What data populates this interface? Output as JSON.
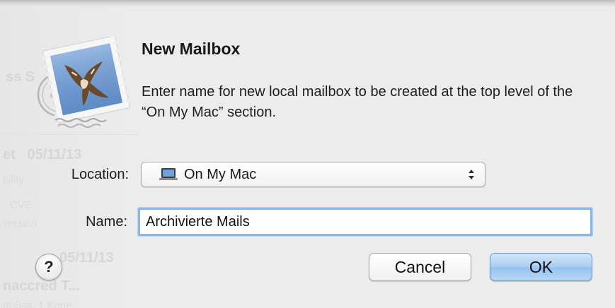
{
  "dialog": {
    "title": "New Mailbox",
    "message": "Enter name for new local mailbox to be created at the top level of the “On My Mac” section.",
    "location": {
      "label": "Location:",
      "value": "On My Mac",
      "icon": "laptop-icon"
    },
    "name": {
      "label": "Name:",
      "value": "Archivierte Mails"
    },
    "help_label": "?",
    "cancel_label": "Cancel",
    "ok_label": "OK"
  },
  "colors": {
    "background": "#ececec",
    "focus_ring": "#8ab6e8",
    "default_button": "#a9cdf3"
  }
}
